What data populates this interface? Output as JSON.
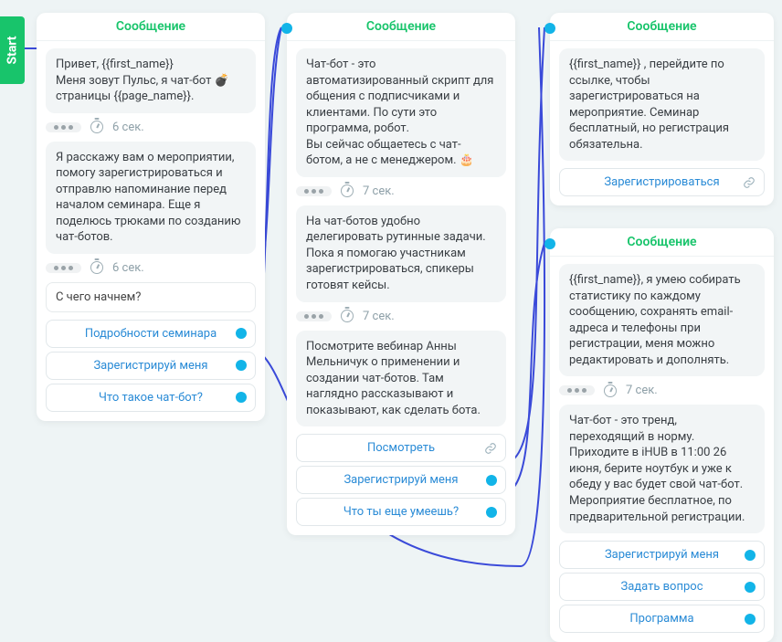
{
  "start_label": "Start",
  "card_title": "Сообщение",
  "delay6": "6 сек.",
  "delay7": "7 сек.",
  "c1": {
    "msg1": "Привет, {{first_name}}\nМеня зовут Пульс, я чат-бот 💣 страницы {{page_name}}.",
    "msg2": "Я расскажу вам о мероприятии, помогу зарегистрироваться и отправлю напоминание перед началом семинара. Еще я поделюсь трюками по созданию чат-ботов.",
    "prompt": "С чего начнем?",
    "opt1": "Подробности семинара",
    "opt2": "Зарегистрируй меня",
    "opt3": "Что такое чат-бот?"
  },
  "c2": {
    "msg1": "Чат-бот - это автоматизированный скрипт для общения с подписчиками и клиентами. По сути это программа, робот.\nВы сейчас общаетесь с чат-ботом, а не с менеджером. 🎂",
    "msg2": "На чат-ботов удобно делегировать рутинные задачи. Пока я помогаю участникам зарегистрироваться, спикеры готовят кейсы.",
    "msg3": "Посмотрите вебинар Анны Мельничук о применении и создании чат-ботов. Там наглядно рассказывают и показывают, как сделать бота.",
    "opt1": "Посмотреть",
    "opt2": "Зарегистрируй меня",
    "opt3": "Что ты еще умеешь?"
  },
  "c3": {
    "msg1": "{{first_name}} , перейдите по ссылке, чтобы зарегистрироваться на мероприятие. Семинар бесплатный, но регистрация обязательна.",
    "opt1": "Зарегистрироваться"
  },
  "c4": {
    "msg1": "{{first_name}}, я умею собирать статистику по каждому сообщению, сохранять email-адреса и телефоны при регистрации, меня можно редактировать и дополнять.",
    "msg2": "Чат-бот - это тренд, переходящий в норму. Приходите в iHUB в 11:00 26 июня, берите ноутбук и уже к обеду у вас будет свой чат-бот. Мероприятие бесплатное, по предварительной регистрации.",
    "opt1": "Зарегистрируй меня",
    "opt2": "Задать вопрос",
    "opt3": "Программа"
  }
}
